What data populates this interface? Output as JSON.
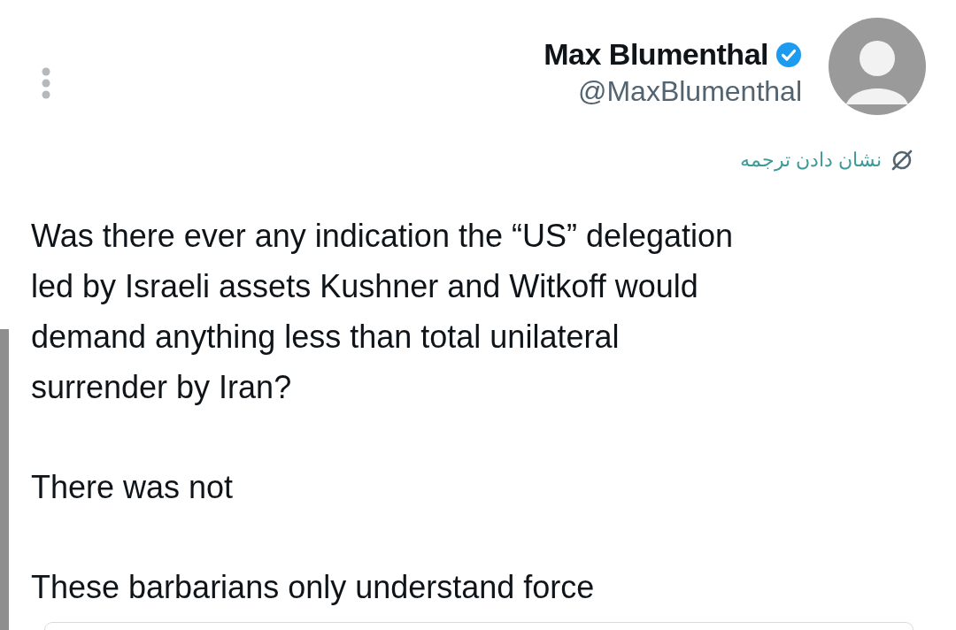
{
  "author": {
    "name": "Max Blumenthal",
    "verified": true,
    "handle": "@MaxBlumenthal"
  },
  "translate_link": "نشان دادن ترجمه",
  "paragraphs": [
    "Was there ever any indication the “US” delegation\nled by Israeli assets Kushner and Witkoff would\ndemand anything less than total unilateral\nsurrender by Iran?",
    "There was not",
    "These barbarians only understand force"
  ]
}
